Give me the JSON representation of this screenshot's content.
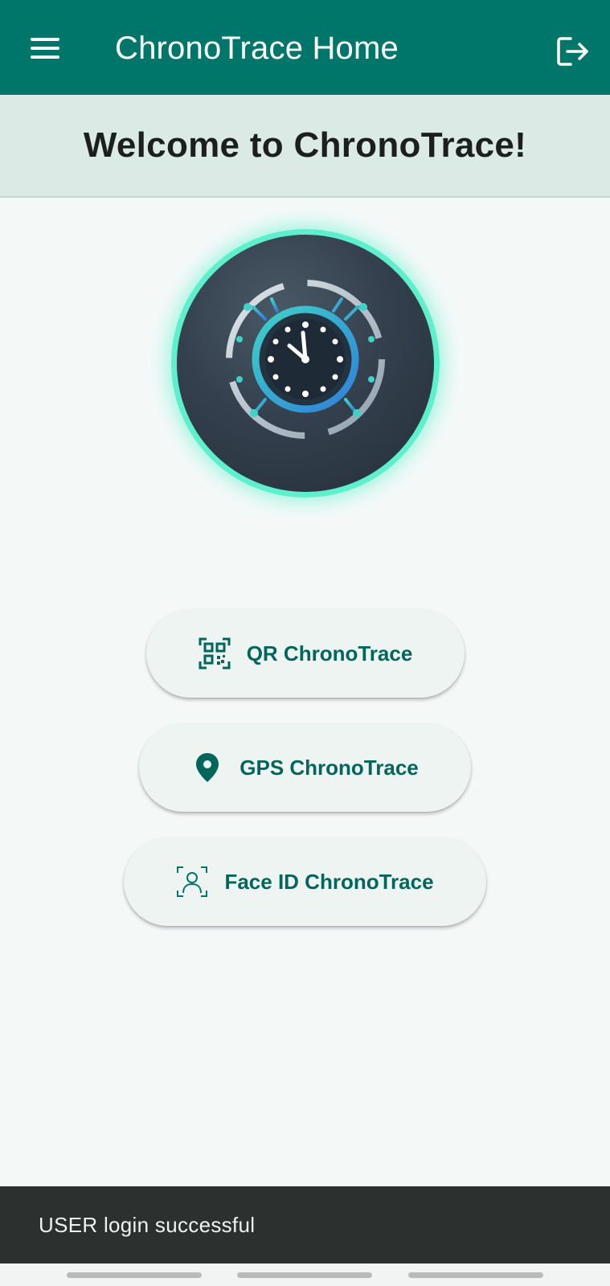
{
  "app_bar": {
    "title": "ChronoTrace Home",
    "menu_icon": "hamburger-menu-icon",
    "logout_icon": "logout-icon",
    "color": "#00766b"
  },
  "welcome": {
    "text": "Welcome to ChronoTrace!"
  },
  "logo": {
    "icon": "clock-circuit-logo",
    "ring_color": "#5ef0cc"
  },
  "actions": [
    {
      "label": "QR ChronoTrace",
      "icon": "qr-code-scan-icon"
    },
    {
      "label": "GPS ChronoTrace",
      "icon": "location-pin-icon"
    },
    {
      "label": "Face ID ChronoTrace",
      "icon": "face-id-icon"
    }
  ],
  "snackbar": {
    "message": "USER login successful"
  }
}
